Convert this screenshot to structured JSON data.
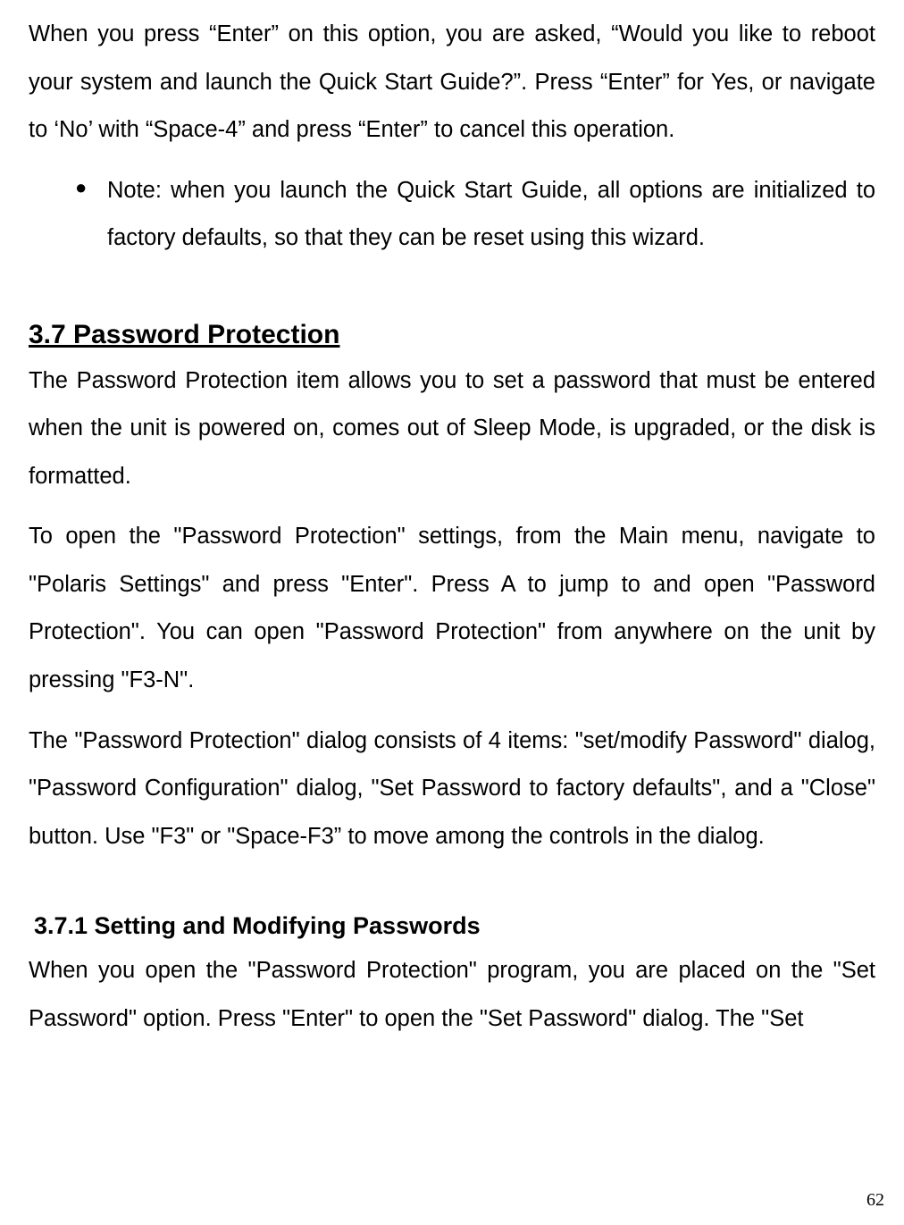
{
  "paragraphs": {
    "intro": "When you press “Enter” on this option, you are asked, “Would you like to reboot your system and launch the Quick Start Guide?”. Press “Enter” for Yes, or navigate to ‘No’ with “Space-4” and press “Enter” to cancel this operation.",
    "note": "Note: when you launch the Quick Start Guide, all options are initialized to factory defaults, so that they can be reset using this wizard.",
    "pw1": "The Password Protection item allows you to set a password that must be entered when the unit is powered on, comes out of Sleep Mode, is upgraded, or the disk is formatted.",
    "pw2": "To open the \"Password Protection\" settings, from the Main menu, navigate to \"Polaris Settings\" and press \"Enter\". Press A to jump to and open \"Password Protection\". You can open \"Password Protection\" from anywhere on the unit by pressing \"F3-N\".",
    "pw3": "The \"Password Protection\" dialog consists of 4 items: \"set/modify Password\" dialog, \"Password Configuration\" dialog, \"Set Password to factory defaults\", and a \"Close\" button. Use \"F3\" or \"Space-F3” to move among the controls in the dialog.",
    "sub1": "When you open the \"Password Protection\" program, you are placed on the \"Set Password\" option. Press \"Enter\" to open the \"Set Password\" dialog. The \"Set"
  },
  "headings": {
    "h2": "3.7 Password Protection",
    "h3": "3.7.1 Setting and Modifying Passwords"
  },
  "page_number": "62"
}
